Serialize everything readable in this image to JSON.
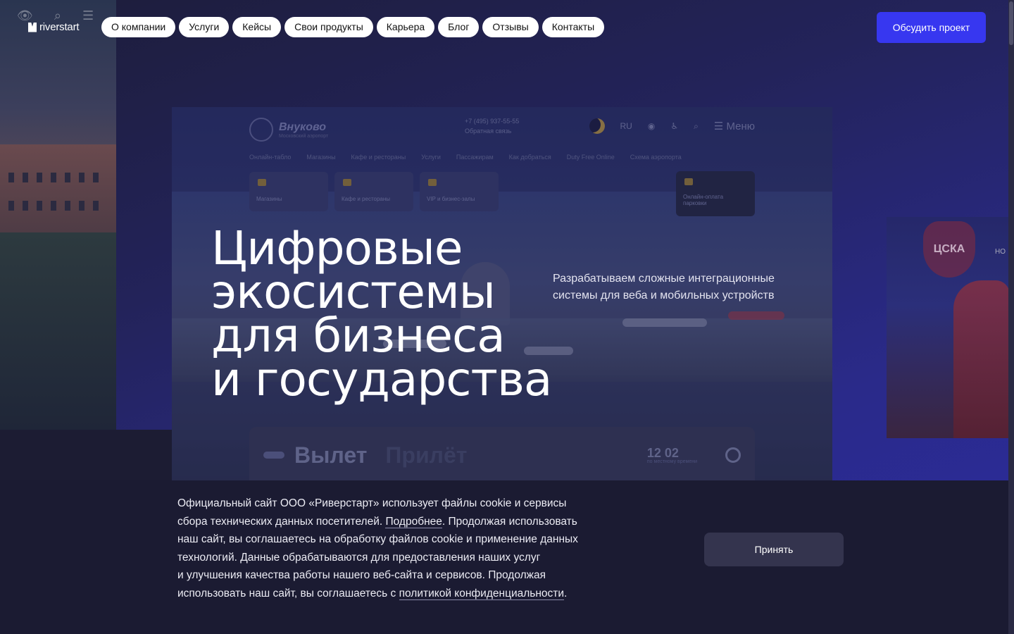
{
  "header": {
    "logo_text": "riverstart",
    "nav": [
      {
        "label": "О компании"
      },
      {
        "label": "Услуги"
      },
      {
        "label": "Кейсы"
      },
      {
        "label": "Свои продукты"
      },
      {
        "label": "Карьера"
      },
      {
        "label": "Блог"
      },
      {
        "label": "Отзывы"
      },
      {
        "label": "Контакты"
      }
    ],
    "cta_label": "Обсудить проект"
  },
  "hero": {
    "title_lines": [
      "Цифровые",
      "экосистемы",
      "для бизнеса",
      "и государства"
    ],
    "subtitle_lines": [
      "Разрабатываем сложные интеграционные",
      "системы для веба и мобильных устройств"
    ]
  },
  "showcase": {
    "logo": "Внуково",
    "logo_sub": "Московский аэропорт",
    "phone": "+7 (495) 937-55-55",
    "phone_sub": "Обратная связь",
    "lang": "RU",
    "menu_label": "Меню",
    "nav": [
      "Онлайн-табло",
      "Магазины",
      "Кафе и рестораны",
      "Услуги",
      "Пассажирам",
      "Как добраться",
      "Duty Free Online",
      "Схема аэропорта"
    ],
    "cards": [
      "Магазины",
      "Кафе и рестораны",
      "VIP и бизнес-залы"
    ],
    "dark_card": "Онлайн-оплата парковки",
    "departure": "Вылет",
    "arrival": "Прилёт",
    "time": "12 02",
    "time_sub": "по местному времени"
  },
  "side_photos": {
    "right_crest": "ЦСКА",
    "right_text": "НО"
  },
  "cookie": {
    "line1": "Официальный сайт ООО «Риверстарт» использует файлы cookie и сервисы",
    "line2_before": "сбора технических данных посетителей. ",
    "line2_link": "Подробнее",
    "line2_after": ". Продолжая использовать",
    "line3": "наш сайт, вы соглашаетесь на обработку файлов cookie и применение данных",
    "line4": "технологий. Данные обрабатываются для предоставления наших услуг",
    "line5": "и улучшения качества работы нашего веб-сайта и сервисов. Продолжая",
    "line6_before": "использовать наш сайт, вы соглашаетесь с ",
    "line6_link": "политикой конфиденциальности",
    "line6_after": ".",
    "accept_label": "Принять"
  },
  "colors": {
    "accent": "#3737f0",
    "background": "#1e1e38",
    "cookie_bg": "#1b1b32",
    "accept_bg": "#34344e"
  }
}
